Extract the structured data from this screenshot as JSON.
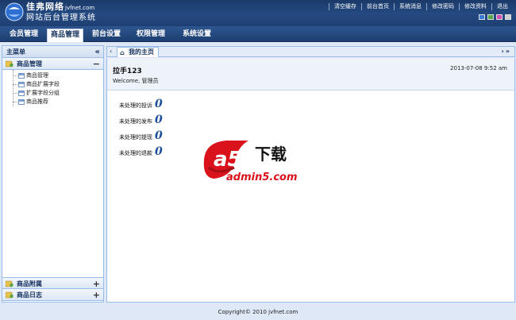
{
  "header": {
    "brand_name": "佳弗网络",
    "brand_domain": "jvfnet.com",
    "brand_subtitle": "网站后台管理系统",
    "top_links": [
      "清空缓存",
      "前台首页",
      "系统消息",
      "修改密码",
      "修改资料",
      "退出"
    ],
    "theme_swatches": [
      "#3a7bd5",
      "#57a64a",
      "#d24fb3",
      "#cfcfcf"
    ]
  },
  "nav": {
    "items": [
      "会员管理",
      "商品管理",
      "前台设置",
      "权限管理",
      "系统设置"
    ],
    "active_index": 1
  },
  "sidebar": {
    "title": "主菜单",
    "collapse_glyph": "«",
    "groups": [
      {
        "title": "商品管理",
        "toggle": "−",
        "expanded": true,
        "items": [
          "商品管理",
          "商品扩展字段",
          "扩展字段分组",
          "商品推荐"
        ]
      },
      {
        "title": "商品附属",
        "toggle": "+",
        "expanded": false
      },
      {
        "title": "商品日志",
        "toggle": "+",
        "expanded": false
      }
    ]
  },
  "tabs": {
    "active": "我的主页",
    "left_arrow": "‹",
    "right_controls": "›»"
  },
  "main": {
    "user": "拉手123",
    "welcome": "Welcome, 管理员",
    "datetime": "2013-07-08 9:52 am",
    "stats": [
      {
        "label": "未处理的投诉",
        "value": "0"
      },
      {
        "label": "未处理的发布",
        "value": "0"
      },
      {
        "label": "未处理的提现",
        "value": "0"
      },
      {
        "label": "未处理的退款",
        "value": "0"
      }
    ],
    "watermark": {
      "mark": "a5",
      "cn": "下载",
      "domain": "admin5.com"
    }
  },
  "footer": {
    "copyright": "Copyright© 2010 jvfnet.com"
  },
  "colors": {
    "header": "#1e3f72",
    "panel_border": "#99bbe8",
    "stat_number": "#1d4f9a",
    "watermark_red": "#d9121b"
  }
}
